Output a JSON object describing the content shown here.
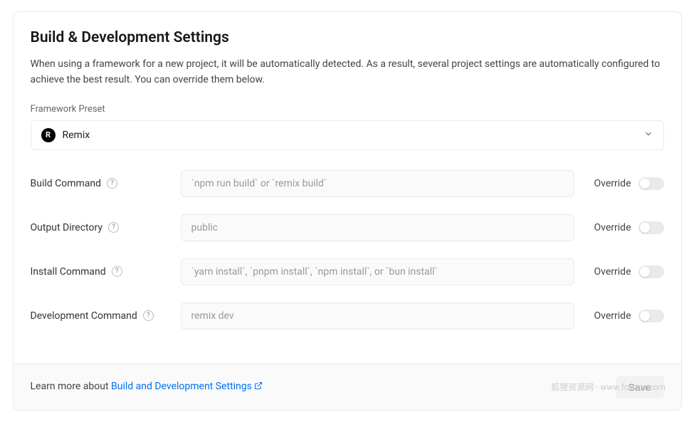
{
  "header": {
    "title": "Build & Development Settings",
    "description": "When using a framework for a new project, it will be automatically detected. As a result, several project settings are automatically configured to achieve the best result. You can override them below."
  },
  "preset": {
    "label": "Framework Preset",
    "value": "Remix",
    "icon": "R"
  },
  "rows": {
    "build": {
      "label": "Build Command",
      "placeholder": "`npm run build` or `remix build`",
      "override_label": "Override"
    },
    "output": {
      "label": "Output Directory",
      "placeholder": "public",
      "override_label": "Override"
    },
    "install": {
      "label": "Install Command",
      "placeholder": "`yarn install`, `pnpm install`, `npm install`, or `bun install`",
      "override_label": "Override"
    },
    "dev": {
      "label": "Development Command",
      "placeholder": "remix dev",
      "override_label": "Override"
    }
  },
  "footer": {
    "prefix": "Learn more about ",
    "link": "Build and Development Settings",
    "save": "Save"
  },
  "watermark": "狐狸资源网 · www.foxccs.com"
}
